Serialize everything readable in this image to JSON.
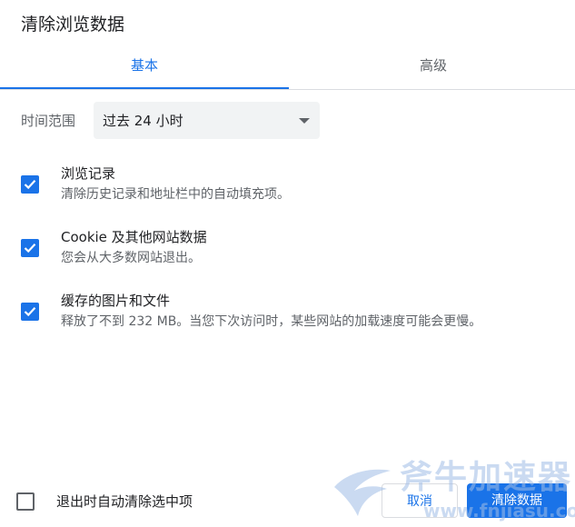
{
  "dialog": {
    "title": "清除浏览数据"
  },
  "tabs": [
    {
      "label": "基本",
      "active": true
    },
    {
      "label": "高级",
      "active": false
    }
  ],
  "time_range": {
    "label": "时间范围",
    "selected": "过去 24 小时"
  },
  "options": [
    {
      "title": "浏览记录",
      "description": "清除历史记录和地址栏中的自动填充项。",
      "checked": true
    },
    {
      "title": "Cookie 及其他网站数据",
      "description": "您会从大多数网站退出。",
      "checked": true
    },
    {
      "title": "缓存的图片和文件",
      "description": "释放了不到 232 MB。当您下次访问时，某些网站的加载速度可能会更慢。",
      "checked": true
    }
  ],
  "footer": {
    "clear_on_exit_label": "退出时自动清除选中项",
    "clear_on_exit_checked": false,
    "cancel_label": "取消",
    "clear_label": "清除数据"
  },
  "watermark": {
    "brand": "斧牛加速器",
    "url": "www.fnjiasu.com"
  },
  "colors": {
    "accent": "#1a73e8",
    "text_primary": "#202124",
    "text_secondary": "#5f6368",
    "select_bg": "#f1f3f4"
  }
}
